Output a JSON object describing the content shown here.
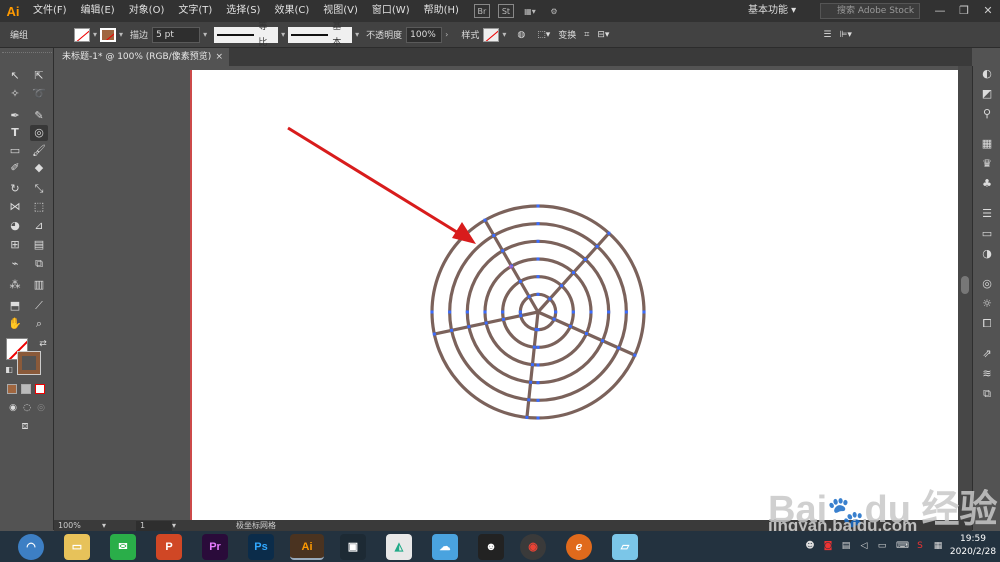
{
  "app": {
    "logo": "Ai"
  },
  "menus": [
    "文件(F)",
    "编辑(E)",
    "对象(O)",
    "文字(T)",
    "选择(S)",
    "效果(C)",
    "视图(V)",
    "窗口(W)",
    "帮助(H)"
  ],
  "menubar_icons": {
    "br": "Br",
    "st": "St"
  },
  "workspace": "基本功能",
  "stock_search_placeholder": "搜索 Adobe Stock",
  "control_bar": {
    "selection_label": "编组",
    "stroke_label": "描边",
    "stroke_weight": "5 pt",
    "profile": "等比",
    "brush": "基本",
    "opacity_label": "不透明度",
    "opacity_value": "100%",
    "style_label": "样式",
    "transform_label": "变换"
  },
  "document_tab": {
    "title": "未标题-1* @ 100% (RGB/像素预览)",
    "close": "×"
  },
  "status": {
    "zoom": "100%",
    "page": "1",
    "tool": "极坐标网格"
  },
  "taskbar": {
    "apps": [
      "Pr",
      "Ps",
      "Ai"
    ],
    "time": "19:59",
    "date": "2020/2/28"
  },
  "drawing": {
    "stroke_color": "#7b625b",
    "anchor_color": "#3a6cff",
    "arrow_color": "#d81c1c",
    "concentric_rings": 6,
    "radial_dividers": 5
  },
  "watermark": {
    "brand": "Bai 经验",
    "url": "jingyan.baidu.com"
  }
}
